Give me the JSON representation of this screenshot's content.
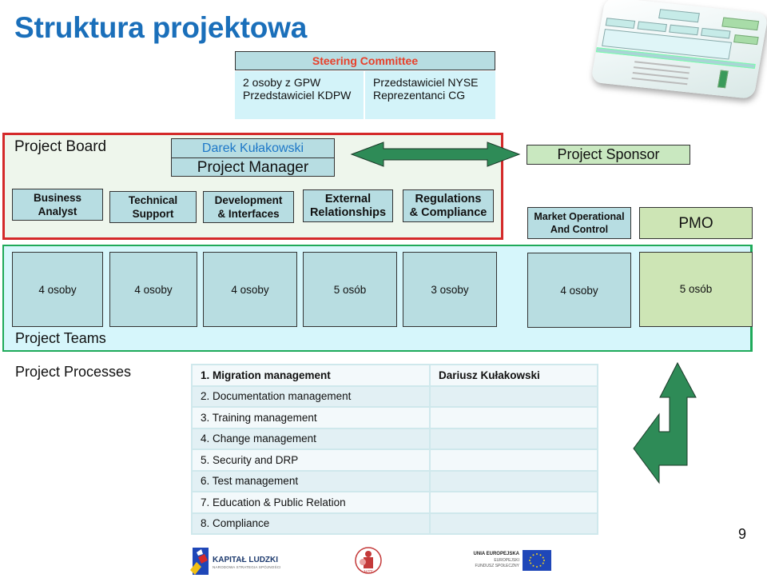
{
  "title": "Struktura projektowa",
  "steering_committee": {
    "header": "Steering Committee",
    "left": [
      "2 osoby z GPW",
      "Przedstawiciel KDPW"
    ],
    "right": [
      "Przedstawiciel NYSE",
      "Reprezentanci CG"
    ]
  },
  "project_board": {
    "label": "Project Board",
    "manager_name": "Darek Kułakowski",
    "manager_role": "Project Manager",
    "roles": [
      {
        "line1": "Business",
        "line2": "Analyst"
      },
      {
        "line1": "Technical",
        "line2": "Support"
      },
      {
        "line1": "Development",
        "line2": "& Interfaces"
      },
      {
        "line1": "External",
        "line2": "Relationships"
      },
      {
        "line1": "Regulations",
        "line2": "& Compliance"
      }
    ]
  },
  "sponsor": "Project Sponsor",
  "market_role": {
    "line1": "Market Operational",
    "line2": "And Control"
  },
  "pmo": "PMO",
  "project_teams": {
    "label": "Project Teams",
    "teams": [
      "4 osoby",
      "4 osoby",
      "4 osoby",
      "5 osób",
      "3 osoby",
      "4 osoby",
      "5 osób"
    ]
  },
  "project_processes": {
    "label": "Project Processes",
    "rows": [
      {
        "process": "1. Migration management",
        "owner": "Dariusz Kułakowski"
      },
      {
        "process": "2. Documentation management",
        "owner": ""
      },
      {
        "process": "3. Training management",
        "owner": ""
      },
      {
        "process": "4. Change management",
        "owner": ""
      },
      {
        "process": "5. Security and DRP",
        "owner": ""
      },
      {
        "process": "6. Test management",
        "owner": ""
      },
      {
        "process": "7. Education & Public Relation",
        "owner": ""
      },
      {
        "process": "8. Compliance",
        "owner": ""
      }
    ]
  },
  "page_number": "9",
  "logos": {
    "kapital_ludzki": {
      "title": "KAPITAŁ LUDZKI",
      "subtitle": "NARODOWA STRATEGIA SPÓJNOŚCI"
    },
    "wit": "WIT",
    "eu": {
      "line1": "UNIA EUROPEJSKA",
      "line2": "EUROPEJSKI",
      "line3": "FUNDUSZ SPOŁECZNY"
    }
  },
  "colors": {
    "title": "#1a6fba",
    "steering_header_text": "#e8402a",
    "board_border": "#d42a2a",
    "teams_border": "#1faa5a",
    "arrow": "#2e8b57",
    "role_box": "#b7dde2",
    "green_box": "#cde5b5"
  }
}
